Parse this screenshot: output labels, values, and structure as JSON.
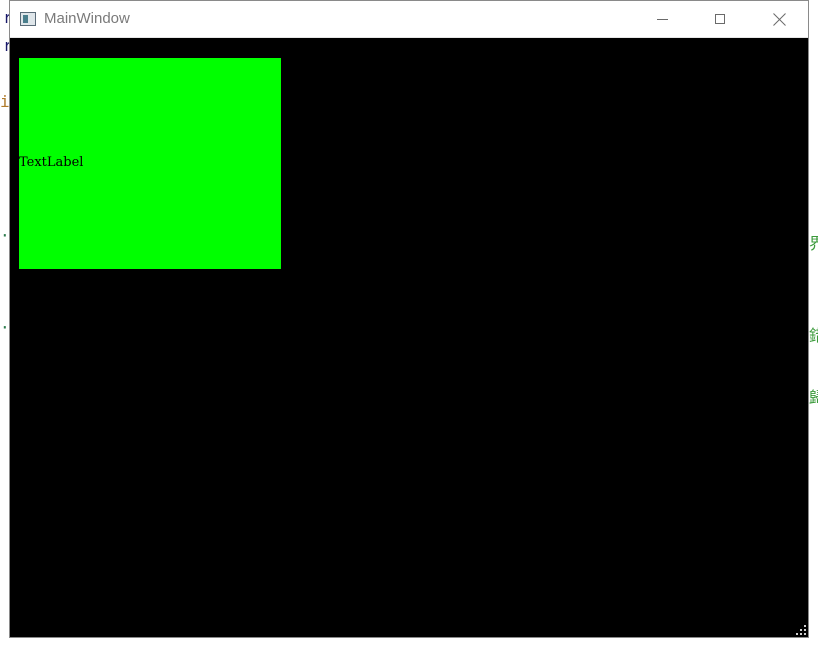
{
  "window": {
    "title": "MainWindow",
    "buttons": {
      "minimize": "minimize-icon",
      "maximize": "maximize-icon",
      "close": "close-icon"
    }
  },
  "content": {
    "label_text": "TextLabel",
    "label_background": "#00ff00",
    "client_background": "#000000"
  },
  "background_fragments": {
    "left": [
      "r",
      "r",
      "i",
      "·",
      "·"
    ],
    "right": [
      "界",
      "錯",
      "歸"
    ]
  }
}
